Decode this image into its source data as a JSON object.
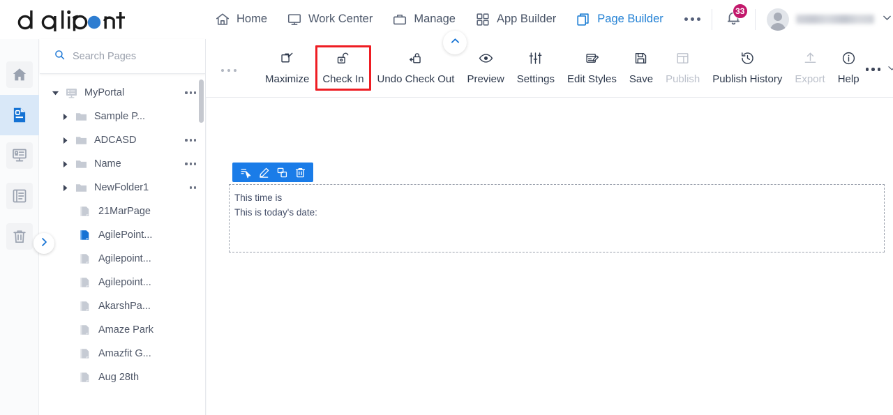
{
  "brand": {
    "logo_text": "agilepoint",
    "accent_blue": "#2e7dd1",
    "active_blue": "#1f7fd4",
    "highlight_red": "#ee1d23",
    "badge_magenta": "#c2186b",
    "toolbar_blue": "#1a7ce8"
  },
  "header": {
    "nav": [
      {
        "label": "Home",
        "icon": "home-icon",
        "active": false
      },
      {
        "label": "Work Center",
        "icon": "monitor-icon",
        "active": false
      },
      {
        "label": "Manage",
        "icon": "briefcase-icon",
        "active": false
      },
      {
        "label": "App Builder",
        "icon": "grid-icon",
        "active": false
      },
      {
        "label": "Page Builder",
        "icon": "copy-pages-icon",
        "active": true
      }
    ],
    "overflow_label": "more-options",
    "notifications": {
      "icon": "bell-icon",
      "count": "33"
    },
    "user": {
      "name": "",
      "avatar_icon": "avatar-icon",
      "chevron": "chevron-down-icon"
    }
  },
  "rail": {
    "items": [
      {
        "icon": "home-icon",
        "name": "rail-item-home",
        "active": false
      },
      {
        "icon": "page-icon",
        "name": "rail-item-pages",
        "active": true
      },
      {
        "icon": "portal-icon",
        "name": "rail-item-portal",
        "active": false
      },
      {
        "icon": "list-icon",
        "name": "rail-item-list",
        "active": false
      },
      {
        "icon": "trash-icon",
        "name": "rail-item-recycle-bin",
        "active": false
      }
    ],
    "expand_icon": "chevron-right-icon"
  },
  "tree": {
    "search": {
      "placeholder": "Search Pages",
      "icon": "search-icon",
      "value": ""
    },
    "nodes": [
      {
        "label": "MyPortal",
        "level": 0,
        "type": "portal",
        "caret": "down",
        "dots": true,
        "active": false
      },
      {
        "label": "Sample P...",
        "level": 1,
        "type": "folder",
        "caret": "right",
        "dots": false,
        "active": false
      },
      {
        "label": "ADCASD",
        "level": 1,
        "type": "folder",
        "caret": "right",
        "dots": true,
        "active": false
      },
      {
        "label": "Name",
        "level": 1,
        "type": "folder",
        "caret": "right",
        "dots": true,
        "active": false
      },
      {
        "label": "NewFolder1",
        "level": 1,
        "type": "folder",
        "caret": "right",
        "dots": true,
        "active": false
      },
      {
        "label": "21MarPage",
        "level": 2,
        "type": "page",
        "caret": "none",
        "dots": false,
        "active": false
      },
      {
        "label": "AgilePoint...",
        "level": 2,
        "type": "page",
        "caret": "none",
        "dots": false,
        "active": true
      },
      {
        "label": "Agilepoint...",
        "level": 2,
        "type": "page",
        "caret": "none",
        "dots": false,
        "active": false
      },
      {
        "label": "Agilepoint...",
        "level": 2,
        "type": "page",
        "caret": "none",
        "dots": false,
        "active": false
      },
      {
        "label": "AkarshPa...",
        "level": 2,
        "type": "page",
        "caret": "none",
        "dots": false,
        "active": false
      },
      {
        "label": "Amaze Park",
        "level": 2,
        "type": "page",
        "caret": "none",
        "dots": false,
        "active": false
      },
      {
        "label": "Amazfit G...",
        "level": 2,
        "type": "page",
        "caret": "none",
        "dots": false,
        "active": false
      },
      {
        "label": "Aug 28th",
        "level": 2,
        "type": "page",
        "caret": "none",
        "dots": false,
        "active": false
      }
    ]
  },
  "toolbar": {
    "overflow_left": "more-options",
    "items": [
      {
        "label": "Maximize",
        "icon": "maximize-icon",
        "disabled": false,
        "highlighted": false
      },
      {
        "label": "Check In",
        "icon": "unlock-icon",
        "disabled": false,
        "highlighted": true
      },
      {
        "label": "Undo Check Out",
        "icon": "lock-undo-icon",
        "disabled": false,
        "highlighted": false
      },
      {
        "label": "Preview",
        "icon": "eye-icon",
        "disabled": false,
        "highlighted": false
      },
      {
        "label": "Settings",
        "icon": "sliders-icon",
        "disabled": false,
        "highlighted": false
      },
      {
        "label": "Edit Styles",
        "icon": "edit-styles-icon",
        "disabled": false,
        "highlighted": false
      },
      {
        "label": "Save",
        "icon": "save-icon",
        "disabled": false,
        "highlighted": false
      },
      {
        "label": "Publish",
        "icon": "publish-icon",
        "disabled": true,
        "highlighted": false
      },
      {
        "label": "Publish History",
        "icon": "history-icon",
        "disabled": false,
        "highlighted": false
      },
      {
        "label": "Export",
        "icon": "upload-icon",
        "disabled": true,
        "highlighted": false
      },
      {
        "label": "Help",
        "icon": "info-icon",
        "disabled": false,
        "highlighted": false
      }
    ],
    "overflow_right": "more-options",
    "overflow_chevron": "chevron-down-icon",
    "collapse_icon": "chevron-up-icon"
  },
  "canvas": {
    "element_toolbar": [
      {
        "icon": "select-element-icon",
        "name": "select-parent-button"
      },
      {
        "icon": "pencil-icon",
        "name": "edit-button"
      },
      {
        "icon": "duplicate-icon",
        "name": "copy-button"
      },
      {
        "icon": "trash-icon",
        "name": "delete-button"
      }
    ],
    "content": {
      "line1": "This time is",
      "line2": "This is today's date:"
    }
  }
}
